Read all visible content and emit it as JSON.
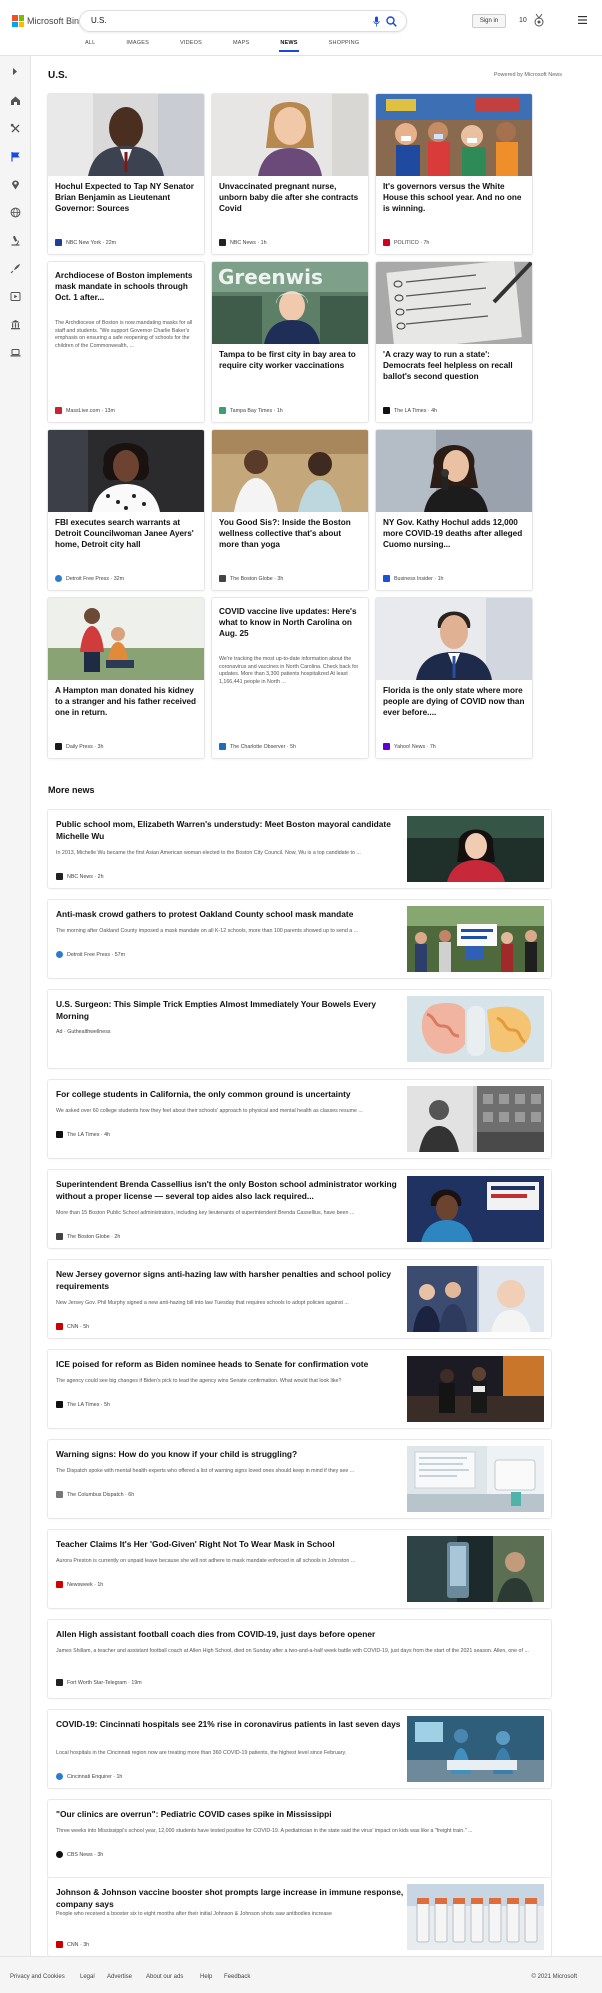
{
  "header": {
    "brand": "Microsoft Bing",
    "search_value": "U.S.",
    "signin_label": "Sign in",
    "rewards_count": "10",
    "brand_colors": [
      "#f25022",
      "#7fba00",
      "#00a4ef",
      "#ffb900"
    ],
    "accent": "#174ae4",
    "icons": [
      "microphone-icon",
      "search-icon",
      "rewards-icon",
      "hamburger-menu-icon"
    ]
  },
  "tabs": [
    {
      "label": "ALL",
      "active": false
    },
    {
      "label": "IMAGES",
      "active": false
    },
    {
      "label": "VIDEOS",
      "active": false
    },
    {
      "label": "MAPS",
      "active": false
    },
    {
      "label": "NEWS",
      "active": true
    },
    {
      "label": "SHOPPING",
      "active": false
    }
  ],
  "sidebar": {
    "icons": [
      "expand-icon",
      "home-icon",
      "tools-icon",
      "flag-icon",
      "location-icon",
      "globe-icon",
      "microscope-icon",
      "rocket-icon",
      "video-icon",
      "bank-icon",
      "laptop-icon"
    ]
  },
  "section": {
    "title": "U.S.",
    "powered": "Powered by Microsoft News"
  },
  "cards": [
    {
      "title": "Hochul Expected to Tap NY Senator Brian Benjamin as Lieutenant Governor: Sources",
      "source": "NBC New York",
      "time": "22m",
      "logo_color": "#1d3e9b"
    },
    {
      "title": "Unvaccinated pregnant nurse, unborn baby die after she contracts Covid",
      "source": "NBC News",
      "time": "1h",
      "logo_color": "#222222"
    },
    {
      "title": "It's governors versus the White House this school year. And no one is winning.",
      "source": "POLITICO",
      "time": "7h",
      "logo_color": "#d0021b"
    },
    {
      "title": "Archdiocese of Boston implements mask mandate in schools through Oct. 1 after...",
      "snippet": "The Archdiocese of Boston is now mandating masks for all staff and students. \"We support Governor Charlie Baker's emphasis on ensuring a safe reopening of schools for the children of the Commonwealth, ...",
      "source": "MassLive.com",
      "time": "13m",
      "logo_color": "#cc2229"
    },
    {
      "title": "Tampa to be first city in bay area to require city worker vaccinations",
      "source": "Tampa Bay Times",
      "time": "1h",
      "logo_color": "#3aa06d"
    },
    {
      "title": "'A crazy way to run a state': Democrats feel helpless on recall ballot's second question",
      "source": "The LA Times",
      "time": "4h",
      "logo_color": "#111111"
    },
    {
      "title": "FBI executes search warrants at Detroit Councilwoman Janee Ayers' home, Detroit city hall",
      "source": "Detroit Free Press",
      "time": "32m",
      "logo_color": "#2a7bd1"
    },
    {
      "title": "You Good Sis?: Inside the Boston wellness collective that's about more than yoga",
      "source": "The Boston Globe",
      "time": "3h",
      "logo_color": "#444444"
    },
    {
      "title": "NY Gov. Kathy Hochul adds 12,000 more COVID-19 deaths after alleged Cuomo nursing...",
      "source": "Business Insider",
      "time": "1h",
      "logo_color": "#1a53d6"
    },
    {
      "title": "A Hampton man donated his kidney to a stranger and his father received one in return.",
      "source": "Daily Press",
      "time": "3h",
      "logo_color": "#1b1b1b"
    },
    {
      "title": "COVID vaccine live updates: Here's what to know in North Carolina on Aug. 25",
      "snippet": "We're tracking the most up-to-date information about the coronavirus and vaccines in North Carolina. Check back for updates. More than 3,300 patients hospitalized At least 1,166,441 people in North ...",
      "source": "The Charlotte Observer",
      "time": "5h",
      "logo_color": "#1c6fb6"
    },
    {
      "title": "Florida is the only state where more people are dying of COVID now than ever before....",
      "source": "Yahoo! News",
      "time": "7h",
      "logo_color": "#6001d2"
    }
  ],
  "more": {
    "title": "More news",
    "items": [
      {
        "title": "Public school mom, Elizabeth Warren's understudy: Meet Boston mayoral candidate Michelle Wu",
        "snippet": "In 2013, Michelle Wu became the first Asian American woman elected to the Boston City Council. Now, Wu is a top candidate to ...",
        "source": "NBC News",
        "time": "2h",
        "logo_color": "#222222"
      },
      {
        "title": "Anti-mask crowd gathers to protest Oakland County school mask mandate",
        "snippet": "The morning after Oakland County imposed a mask mandate on all K-12 schools, more than 100 parents showed up to send a ...",
        "source": "Detroit Free Press",
        "time": "57m",
        "logo_color": "#2a7bd1"
      },
      {
        "title": "U.S. Surgeon: This Simple Trick Empties Almost Immediately Your Bowels Every Morning",
        "snippet": "",
        "source": "Guthealthwellness",
        "ad": "Ad",
        "time": "",
        "logo_color": ""
      },
      {
        "title": "For college students in California, the only common ground is uncertainty",
        "snippet": "We asked over 60 college students how they feel about their schools' approach to physical and mental health as classes resume ...",
        "source": "The LA Times",
        "time": "4h",
        "logo_color": "#111111"
      },
      {
        "title": "Superintendent Brenda Cassellius isn't the only Boston school administrator working without a proper license — several top aides also lack required...",
        "snippet": "More than 15 Boston Public School administrators, including key lieutenants of superintendent Brenda Cassellius, have been ...",
        "source": "The Boston Globe",
        "time": "2h",
        "logo_color": "#444444"
      },
      {
        "title": "New Jersey governor signs anti-hazing law with harsher penalties and school policy requirements",
        "snippet": "New Jersey Gov. Phil Murphy signed a new anti-hazing bill into law Tuesday that requires schools to adopt policies against ...",
        "source": "CNN",
        "time": "5h",
        "logo_color": "#cc0000"
      },
      {
        "title": "ICE poised for reform as Biden nominee heads to Senate for confirmation vote",
        "snippet": "The agency could see big changes if Biden's pick to lead the agency wins Senate confirmation. What would that look like?",
        "source": "The LA Times",
        "time": "5h",
        "logo_color": "#111111"
      },
      {
        "title": "Warning signs: How do you know if your child is struggling?",
        "snippet": "The Dispatch spoke with mental health experts who offered a list of warning signs loved ones should keep in mind if they see ...",
        "source": "The Columbus Dispatch",
        "time": "6h",
        "logo_color": "#777777"
      },
      {
        "title": "Teacher Claims It's Her 'God-Given' Right Not To Wear Mask in School",
        "snippet": "Aurora Preston is currently on unpaid leave because she will not adhere to mask mandate enforced in all schools in Johnston ...",
        "source": "Newsweek",
        "time": "1h",
        "logo_color": "#d40000"
      },
      {
        "title": "Allen High assistant football coach dies from COVID-19, just days before opener",
        "snippet": "James Shillam, a teacher and assistant football coach at Allen High School, died on Sunday after a two-and-a-half week battle with COVID-19, just days from the start of the 2021 season. Allen, one of ...",
        "source": "Fort Worth Star-Telegram",
        "time": "19m",
        "logo_color": "#222222"
      },
      {
        "title": "COVID-19: Cincinnati hospitals see 21% rise in coronavirus patients in last seven days",
        "snippet": "Local hospitals in the Cincinnati region now are treating more than 360 COVID-19 patients, the highest level since February.",
        "source": "Cincinnati Enquirer",
        "time": "1h",
        "logo_color": "#2a7bd1"
      },
      {
        "title": "\"Our clinics are overrun\": Pediatric COVID cases spike in Mississippi",
        "snippet": "Three weeks into Mississippi's school year, 12,000 students have tested positive for COVID-19. A pediatrician in the state said the virus' impact on kids was like a \"freight train.\" ...",
        "source": "CBS News",
        "time": "3h",
        "logo_color": "#111111"
      },
      {
        "title": "Johnson & Johnson vaccine booster shot prompts large increase in immune response, company says",
        "snippet": "People who received a booster six to eight months after their initial Johnson & Johnson shots saw antibodies increase",
        "source": "CNN",
        "time": "3h",
        "logo_color": "#cc0000"
      }
    ]
  },
  "footer": {
    "links": [
      "Privacy and Cookies",
      "Legal",
      "Advertise",
      "About our ads",
      "Help",
      "Feedback"
    ],
    "copyright": "© 2021 Microsoft"
  }
}
